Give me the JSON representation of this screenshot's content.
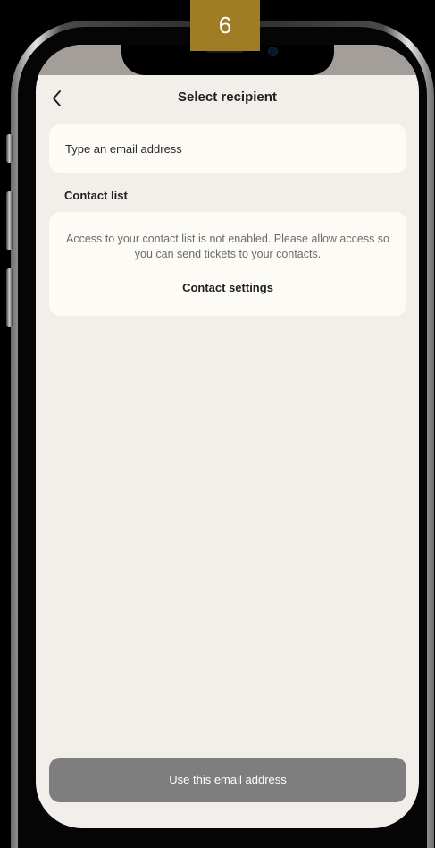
{
  "step_badge": "6",
  "header": {
    "title": "Select recipient"
  },
  "email": {
    "placeholder": "Type an email address",
    "value": ""
  },
  "contacts": {
    "section_label": "Contact list",
    "message": "Access to your contact list is not enabled. Please allow access so you can send tickets to your contacts.",
    "settings_label": "Contact settings"
  },
  "footer": {
    "button_label": "Use this email address"
  },
  "icons": {
    "back": "chevron-left-icon"
  },
  "colors": {
    "screen_background": "#f2eee9",
    "card_background": "#fdfbf5",
    "button_disabled": "#7e7e7e",
    "step_badge": "#a07c25"
  }
}
